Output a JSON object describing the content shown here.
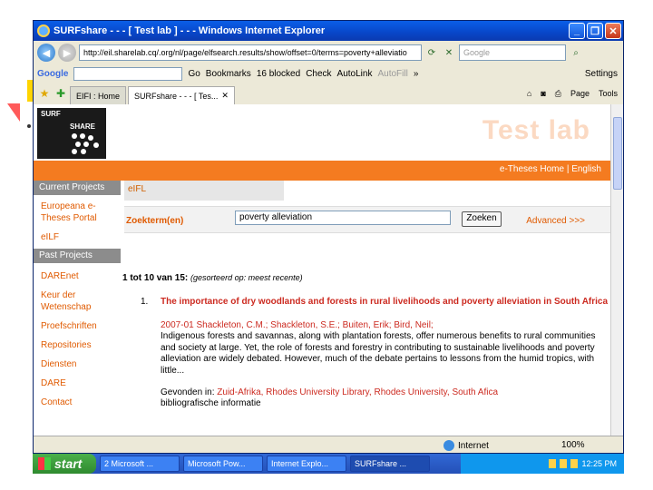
{
  "window": {
    "title": "SURFshare - - - [ Test lab ] - - - Windows Internet Explorer",
    "controls": [
      "_",
      "❐",
      "✕"
    ]
  },
  "address": {
    "url": "http://eil.sharelab.cq/.org/nl/page/elfsearch.results/show/offset=0/terms=poverty+alleviatio",
    "search_placeholder": "Google"
  },
  "google_toolbar": {
    "logo": "Google",
    "go": "Go",
    "bookmarks": "Bookmarks",
    "blocked": "16 blocked",
    "check": "Check",
    "autolink": "AutoLink",
    "autofill": "AutoFill",
    "more": "»",
    "settings": "Settings"
  },
  "tabs": [
    {
      "label": "EIFI : Home",
      "active": false
    },
    {
      "label": "SURFshare - - - [ Tes...",
      "active": true
    }
  ],
  "command_bar": {
    "page": "Page",
    "tools": "Tools"
  },
  "banner": {
    "surf": "SURF",
    "share": "SHARE",
    "testlab": "Test lab"
  },
  "topnav": "e-Theses Home | English",
  "sidebar": {
    "current_heading": "Current Projects",
    "current_items": [
      "Europeana e-Theses Portal",
      "eILF"
    ],
    "past_heading": "Past Projects",
    "past_items": [
      "DAREnet",
      "Keur der Wetenschap",
      "Proefschriften",
      "Repositories",
      "Diensten",
      "DARE",
      "Contact"
    ]
  },
  "search": {
    "tab": "eIFL",
    "label": "Zoekterm(en)",
    "value": "poverty alleviation",
    "button": "Zoeken",
    "advanced": "Advanced >>>"
  },
  "results": {
    "count": "1 tot 10 van 15:",
    "sort": "(gesorteerd op: meest recente)",
    "items": [
      {
        "num": "1.",
        "title": "The importance of dry woodlands and forests in rural livelihoods and poverty alleviation in South Africa",
        "authors": "2007-01 Shackleton, C.M.; Shackleton, S.E.; Buiten, Erik; Bird, Neil;",
        "abstract": "Indigenous forests and savannas, along with plantation forests, offer numerous benefits to rural communities and society at large. Yet, the role of forests and forestry in contributing to sustainable livelihoods and poverty alleviation are widely debated. However, much of the debate pertains to lessons from the humid tropics, with little...",
        "found_label": "Gevonden in:",
        "found_in": "Zuid-Afrika, Rhodes University Library, Rhodes University, South Afica",
        "bib": "bibliografische informatie"
      }
    ]
  },
  "statusbar": {
    "zone": "Internet",
    "zoom": "100%"
  },
  "taskbar": {
    "start": "start",
    "items": [
      "2 Microsoft ...",
      "Microsoft Pow...",
      "Internet Explo...",
      "SURFshare ..."
    ],
    "clock": "12:25 PM"
  },
  "colors": {
    "accent_orange": "#f47b20",
    "link_orange": "#e05a00",
    "result_red": "#cc2a20",
    "title_blue": "#0a5fe8"
  }
}
